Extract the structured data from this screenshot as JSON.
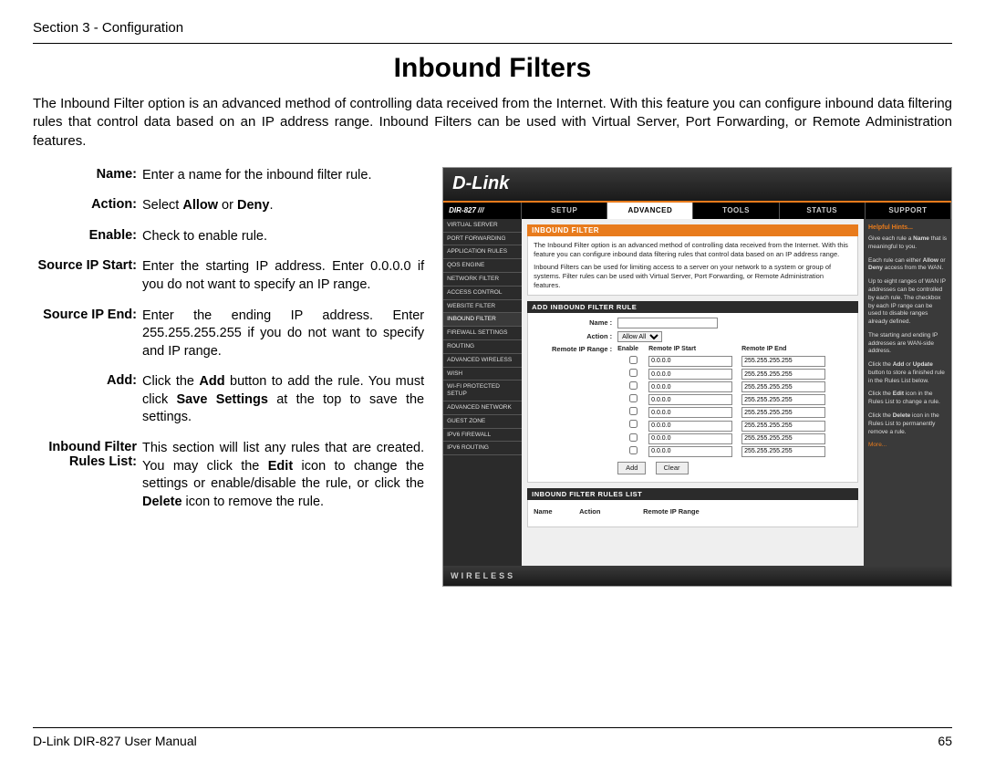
{
  "header": {
    "section": "Section 3 - Configuration"
  },
  "title": "Inbound Filters",
  "intro": "The Inbound Filter option is an advanced method of controlling data received from the Internet. With this feature you can configure inbound data filtering rules that control data based on an IP address range. Inbound Filters can be used with Virtual Server, Port Forwarding, or Remote Administration features.",
  "defs": [
    {
      "label": "Name:",
      "text": "Enter a name for the inbound filter rule."
    },
    {
      "label": "Action:",
      "text": "Select <b>Allow</b> or <b>Deny</b>."
    },
    {
      "label": "Enable:",
      "text": "Check to enable rule."
    },
    {
      "label": "Source IP Start:",
      "text": "Enter the starting IP address. Enter 0.0.0.0 if you do not want to specify an IP range."
    },
    {
      "label": "Source IP End:",
      "text": "Enter the ending IP address. Enter 255.255.255.255 if you do not want to specify and IP range."
    },
    {
      "label": "Add:",
      "text": "Click the <b>Add</b> button to add the rule. You must click <b>Save Settings</b> at the top to save the settings."
    },
    {
      "label": "Inbound Filter Rules List:",
      "text": "This section will list any rules that are created. You may click the <b>Edit</b> icon to change the settings or enable/disable the rule, or click the <b>Delete</b> icon to remove the rule."
    }
  ],
  "shot": {
    "brand": "D-Link",
    "model": "DIR-827",
    "tabs": [
      "SETUP",
      "ADVANCED",
      "TOOLS",
      "STATUS",
      "SUPPORT"
    ],
    "active_tab": 1,
    "sidebar": [
      "VIRTUAL SERVER",
      "PORT FORWARDING",
      "APPLICATION RULES",
      "QOS ENGINE",
      "NETWORK FILTER",
      "ACCESS CONTROL",
      "WEBSITE FILTER",
      "INBOUND FILTER",
      "FIREWALL SETTINGS",
      "ROUTING",
      "ADVANCED WIRELESS",
      "WISH",
      "WI-FI PROTECTED SETUP",
      "ADVANCED NETWORK",
      "GUEST ZONE",
      "IPV6 FIREWALL",
      "IPV6 ROUTING"
    ],
    "sidebar_active": 7,
    "panel_title": "INBOUND FILTER",
    "panel_desc1": "The Inbound Filter option is an advanced method of controlling data received from the Internet. With this feature you can configure inbound data filtering rules that control data based on an IP address range.",
    "panel_desc2": "Inbound Filters can be used for limiting access to a server on your network to a system or group of systems. Filter rules can be used with Virtual Server, Port Forwarding, or Remote Administration features.",
    "add_title": "ADD INBOUND FILTER RULE",
    "name_label": "Name :",
    "action_label": "Action :",
    "action_value": "Allow All",
    "range_label": "Remote IP Range :",
    "col_enable": "Enable",
    "col_start": "Remote IP Start",
    "col_end": "Remote IP End",
    "ip_start_default": "0.0.0.0",
    "ip_end_default": "255.255.255.255",
    "row_count": 8,
    "btn_add": "Add",
    "btn_clear": "Clear",
    "list_title": "INBOUND FILTER RULES LIST",
    "list_cols": [
      "Name",
      "Action",
      "Remote IP Range"
    ],
    "footer_brand": "WIRELESS",
    "hints": {
      "title": "Helpful Hints...",
      "p1": "Give each rule a <b>Name</b> that is meaningful to you.",
      "p2": "Each rule can either <b>Allow</b> or <b>Deny</b> access from the WAN.",
      "p3": "Up to eight ranges of WAN IP addresses can be controlled by each rule. The checkbox by each IP range can be used to disable ranges already defined.",
      "p4": "The starting and ending IP addresses are WAN-side address.",
      "p5": "Click the <b>Add</b> or <b>Update</b> button to store a finished rule in the Rules List below.",
      "p6": "Click the <b>Edit</b> icon in the Rules List to change a rule.",
      "p7": "Click the <b>Delete</b> icon in the Rules List to permanently remove a rule.",
      "more": "More..."
    }
  },
  "footer": {
    "left": "D-Link DIR-827 User Manual",
    "right": "65"
  }
}
